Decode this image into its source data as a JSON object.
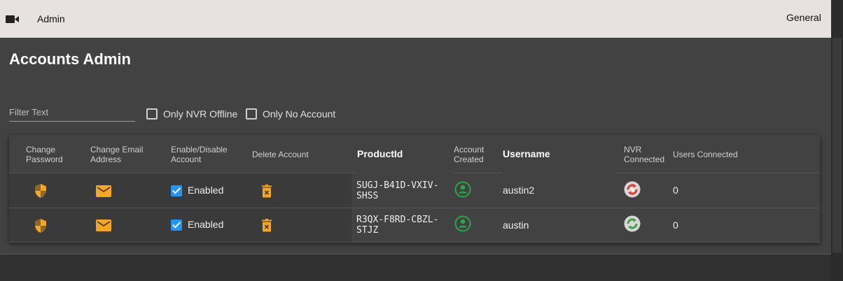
{
  "header": {
    "app_label": "Admin",
    "menu_label": "General",
    "icon": "video-camera-icon"
  },
  "page": {
    "title": "Accounts Admin"
  },
  "filters": {
    "placeholder": "Filter Text",
    "only_nvr_offline": "Only NVR Offline",
    "only_no_account": "Only No Account"
  },
  "table": {
    "headers": {
      "change_password": "Change Password",
      "change_email": "Change Email Address",
      "enable_disable": "Enable/Disable Account",
      "delete_account": "Delete Account",
      "product_id": "ProductId",
      "account_created": "Account Created",
      "username": "Username",
      "nvr_connected": "NVR Connected",
      "users_connected": "Users Connected"
    },
    "rows": [
      {
        "enabled_label": "Enabled",
        "product_id_line1": "SUGJ-B41D-VXIV-",
        "product_id_line2": "SHSS",
        "username": "austin2",
        "nvr_status": "disconnected",
        "users_connected": "0"
      },
      {
        "enabled_label": "Enabled",
        "product_id_line1": "R3QX-F8RD-CBZL-",
        "product_id_line2": "STJZ",
        "username": "austin",
        "nvr_status": "connected",
        "users_connected": "0"
      }
    ]
  },
  "colors": {
    "accent_orange": "#f5a623",
    "checkbox_blue": "#2196f3",
    "account_green": "#27a844",
    "nvr_off_red": "#e53935",
    "nvr_on_green": "#43a047"
  }
}
